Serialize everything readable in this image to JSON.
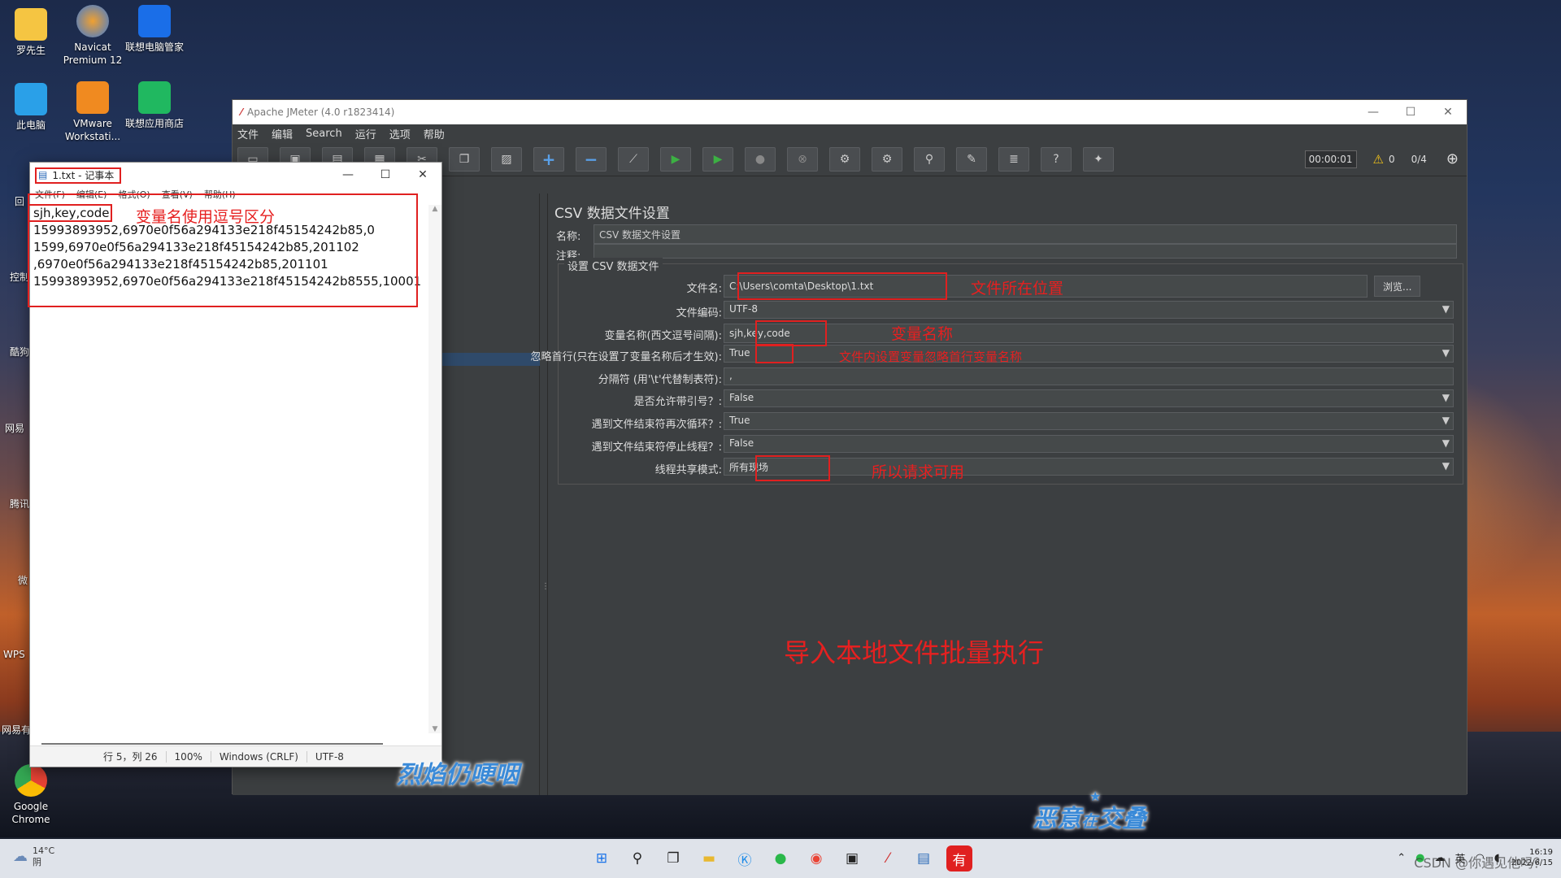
{
  "desktop": {
    "icons": [
      {
        "label": "罗先生"
      },
      {
        "label": "Navicat\nPremium 12"
      },
      {
        "label": "联想电脑管家"
      },
      {
        "label": "此电脑"
      },
      {
        "label": "VMware\nWorkstati..."
      },
      {
        "label": "联想应用商店"
      },
      {
        "label": "Google\nChrome"
      }
    ],
    "partial_labels": [
      "回",
      "控制",
      "酷狗",
      "网易",
      "腾讯",
      "微",
      "WPS",
      "网易有"
    ]
  },
  "jmeter": {
    "title": "Apache JMeter (4.0 r1823414)",
    "menu": [
      "文件",
      "编辑",
      "Search",
      "运行",
      "选项",
      "帮助"
    ],
    "timer": "00:00:01",
    "warn_count": "0",
    "threads": "0/4",
    "panel": {
      "title": "CSV 数据文件设置",
      "name_label": "名称:",
      "name_value": "CSV 数据文件设置",
      "comment_label": "注释:",
      "group_title": "设置 CSV 数据文件",
      "browse_label": "浏览...",
      "fields": [
        {
          "label": "文件名:",
          "value": "C:\\Users\\comta\\Desktop\\1.txt"
        },
        {
          "label": "文件编码:",
          "value": "UTF-8"
        },
        {
          "label": "变量名称(西文逗号间隔):",
          "value": "sjh,key,code"
        },
        {
          "label": "忽略首行(只在设置了变量名称后才生效):",
          "value": "True"
        },
        {
          "label": "分隔符 (用'\\t'代替制表符):",
          "value": ","
        },
        {
          "label": "是否允许带引号？:",
          "value": "False"
        },
        {
          "label": "遇到文件结束符再次循环？:",
          "value": "True"
        },
        {
          "label": "遇到文件结束符停止线程？:",
          "value": "False"
        },
        {
          "label": "线程共享模式:",
          "value": "所有现场"
        }
      ]
    },
    "annotations": {
      "file_location": "文件所在位置",
      "var_name": "变量名称",
      "ignore_first": "文件内设置变量忽略首行变量名称",
      "share_mode": "所以请求可用",
      "main": "导入本地文件批量执行"
    }
  },
  "notepad": {
    "title": "1.txt - 记事本",
    "menu": [
      "文件(F)",
      "编辑(E)",
      "格式(O)",
      "查看(V)",
      "帮助(H)"
    ],
    "lines": [
      "sjh,key,code",
      "15993893952,6970e0f56a294133e218f45154242b85,0",
      "1599,6970e0f56a294133e218f45154242b85,201102",
      ",6970e0f56a294133e218f45154242b85,201101",
      "15993893952,6970e0f56a294133e218f45154242b8555,10001"
    ],
    "annotation": "变量名使用逗号区分",
    "status": {
      "position": "行 5，列 26",
      "zoom": "100%",
      "line_ending": "Windows (CRLF)",
      "encoding": "UTF-8"
    }
  },
  "watermarks": {
    "left": "烈焰仍哽咽",
    "right_a": "恶意",
    "right_b": "在",
    "right_c": "交叠"
  },
  "taskbar": {
    "weather_temp": "14°C",
    "weather_desc": "阴",
    "lang": "英",
    "time": "16:19",
    "date": "2022/6/15",
    "overlay": "CSDN @你遇见他吗？"
  }
}
